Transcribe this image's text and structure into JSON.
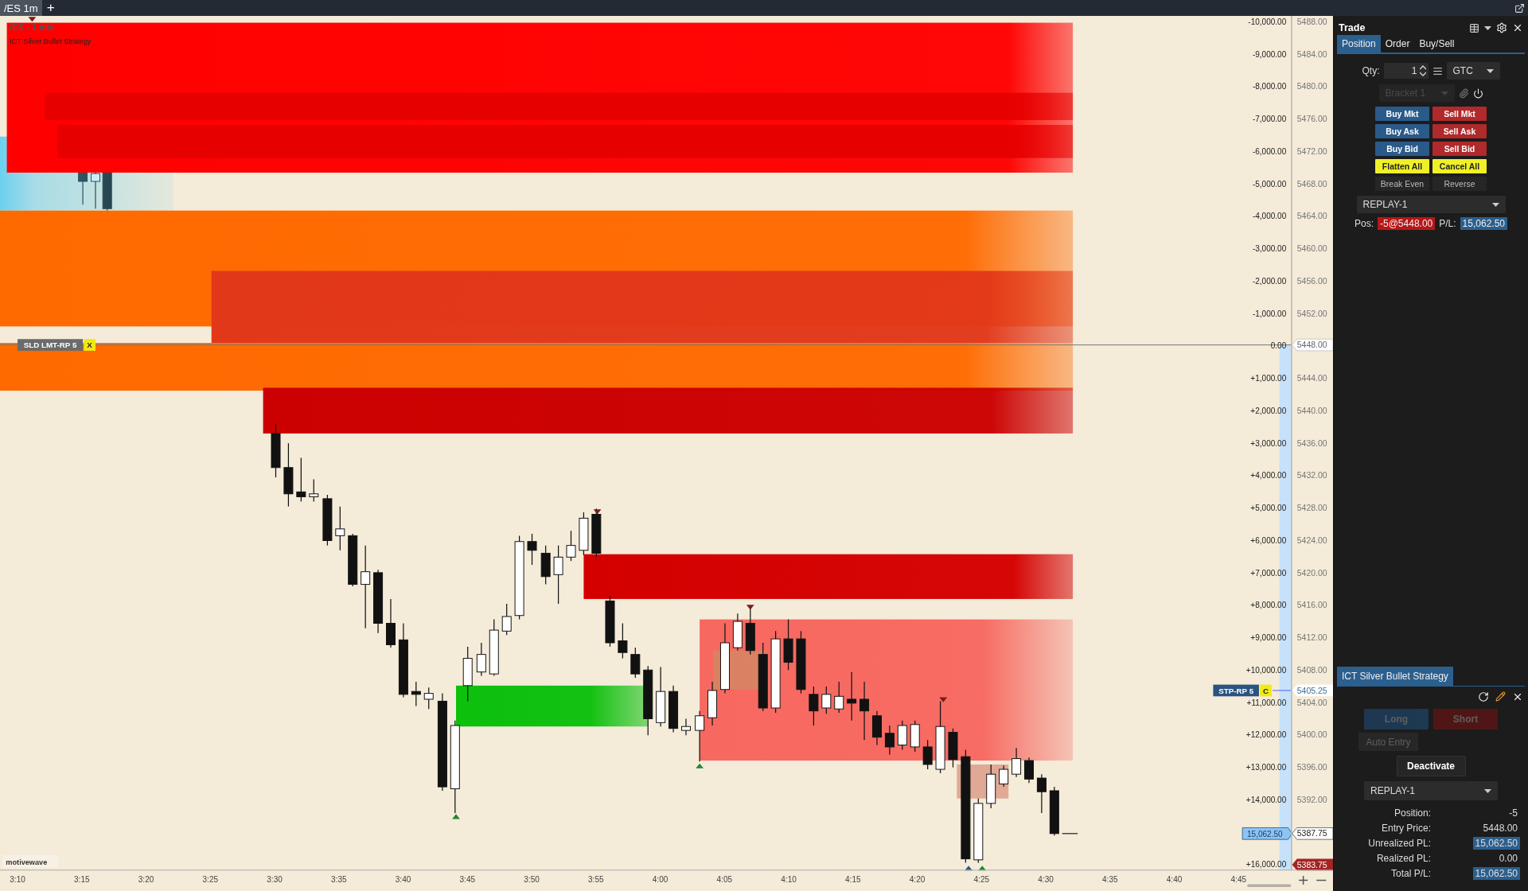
{
  "tabs": [
    {
      "label": "/ES 1m",
      "selected": true
    }
  ],
  "add_tab": "+",
  "chart": {
    "title": "/ES - 1 min",
    "study": "ICT Silver Bullet Strategy",
    "brand": "motivewave",
    "pl_ticks": [
      "-10,000.00",
      "-9,000.00",
      "-8,000.00",
      "-7,000.00",
      "-6,000.00",
      "-5,000.00",
      "-4,000.00",
      "-3,000.00",
      "-2,000.00",
      "-1,000.00",
      "0.00",
      "+1,000.00",
      "+2,000.00",
      "+3,000.00",
      "+4,000.00",
      "+5,000.00",
      "+6,000.00",
      "+7,000.00",
      "+8,000.00",
      "+9,000.00",
      "+10,000.00",
      "+11,000.00",
      "+12,000.00",
      "+13,000.00",
      "+14,000.00",
      "+16,000.00"
    ],
    "price_ticks": [
      "5488.00",
      "5484.00",
      "5480.00",
      "5476.00",
      "5472.00",
      "5468.00",
      "5464.00",
      "5460.00",
      "5456.00",
      "5452.00",
      "5444.00",
      "5440.00",
      "5436.00",
      "5432.00",
      "5428.00",
      "5424.00",
      "5420.00",
      "5416.00",
      "5412.00",
      "5408.00",
      "5404.00",
      "5400.00",
      "5396.00",
      "5392.00"
    ],
    "time_ticks": [
      "3:10",
      "3:15",
      "3:20",
      "3:25",
      "3:30",
      "3:35",
      "3:40",
      "3:45",
      "3:50",
      "3:55",
      "4:00",
      "4:05",
      "4:10",
      "4:15",
      "4:20",
      "4:25",
      "4:30",
      "4:35",
      "4:40",
      "4:45"
    ],
    "order_labels": [
      {
        "kind": "limit",
        "text": "SLD LMT-RP 5",
        "action": "X"
      },
      {
        "kind": "stop",
        "text": "STP-RP 5",
        "action": "C"
      }
    ],
    "price_markers": [
      {
        "kind": "entry",
        "text": "5448.00"
      },
      {
        "kind": "stop",
        "text": "5405.25"
      },
      {
        "kind": "last",
        "text": "5387.75"
      },
      {
        "kind": "low",
        "text": "5383.75"
      }
    ],
    "pl_marker": "15,062.50"
  },
  "trade": {
    "title": "Trade",
    "tabs": [
      {
        "label": "Position",
        "selected": true
      },
      {
        "label": "Order",
        "selected": false
      },
      {
        "label": "Buy/Sell",
        "selected": false
      }
    ],
    "qty_label": "Qty:",
    "qty": "1",
    "tif": "GTC",
    "bracket": {
      "value": "Bracket 1",
      "disabled": true
    },
    "buttons": [
      {
        "label": "Buy Mkt",
        "kind": "buy"
      },
      {
        "label": "Sell Mkt",
        "kind": "sell"
      },
      {
        "label": "Buy Ask",
        "kind": "buy"
      },
      {
        "label": "Sell Ask",
        "kind": "sell"
      },
      {
        "label": "Buy Bid",
        "kind": "buy"
      },
      {
        "label": "Sell Bid",
        "kind": "sell"
      },
      {
        "label": "Flatten All",
        "kind": "flatten"
      },
      {
        "label": "Cancel All",
        "kind": "flatten"
      },
      {
        "label": "Break Even",
        "kind": "neutral"
      },
      {
        "label": "Reverse",
        "kind": "neutral"
      }
    ],
    "account": "REPLAY-1",
    "pos_label": "Pos:",
    "pos": "-5@5448.00",
    "pl_label": "P/L:",
    "pl": "15,062.50"
  },
  "strategy": {
    "tab": "ICT Silver Bullet Strategy",
    "long": {
      "label": "Long",
      "disabled": true
    },
    "short": {
      "label": "Short",
      "disabled": true
    },
    "auto_entry": {
      "label": "Auto Entry",
      "disabled": true
    },
    "deactivate": "Deactivate",
    "account": "REPLAY-1",
    "stats": [
      {
        "label": "Position:",
        "value": "-5",
        "highlight": false
      },
      {
        "label": "Entry Price:",
        "value": "5448.00",
        "highlight": false
      },
      {
        "label": "Unrealized PL:",
        "value": "15,062.50",
        "highlight": true
      },
      {
        "label": "Realized PL:",
        "value": "0.00",
        "highlight": false
      },
      {
        "label": "Total P/L:",
        "value": "15,062.50",
        "highlight": true
      }
    ]
  }
}
